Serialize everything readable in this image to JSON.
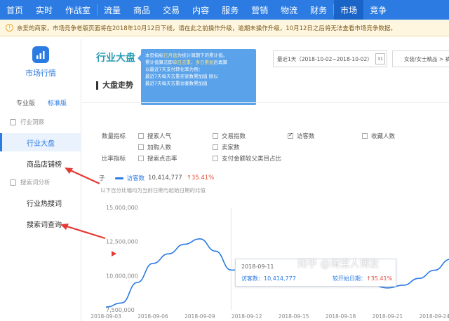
{
  "topnav": {
    "items": [
      {
        "label": "首页"
      },
      {
        "label": "实时"
      },
      {
        "label": "作战室"
      },
      {
        "label": "流量"
      },
      {
        "label": "商品"
      },
      {
        "label": "交易"
      },
      {
        "label": "内容"
      },
      {
        "label": "服务"
      },
      {
        "label": "营销"
      },
      {
        "label": "物流"
      },
      {
        "label": "财务"
      },
      {
        "label": "市场"
      },
      {
        "label": "竞争"
      }
    ],
    "active": "市场"
  },
  "notice": {
    "text": "亲爱的商家，市场竞争老版页面将在2018年10月12日下线，请在此之前操作升级，逾期未操作升级，10月12日之后将无法查看市场竞争数据。"
  },
  "sidebar": {
    "title": "市场行情",
    "version_tabs": [
      "专业版",
      "标准版"
    ],
    "groups": [
      {
        "label": "行业洞察",
        "items": [
          {
            "label": "行业大盘",
            "active": true
          },
          {
            "label": "商品店铺榜"
          }
        ]
      },
      {
        "label": "搜索词分析",
        "items": [
          {
            "label": "行业热搜词"
          },
          {
            "label": "搜索词查询"
          }
        ]
      }
    ]
  },
  "main": {
    "title": "行业大盘",
    "tooltip": {
      "l1a": "本页指标",
      "l1b": "已月盘",
      "l1c": "为统计周期下的累计值。",
      "l2a": "累计值算法即",
      "l2b": "单日去重，多日累加",
      "l2c": "后再算",
      "l3": "以最近7天支付转化率为例：",
      "l4": "最近7天每天去重买家数累加值 除以",
      "l5": "最近7天每天去重访客数累加值"
    },
    "date_range": "最近1天（2018-10-02~2018-10-02）",
    "calendar_label": "31",
    "category": "女装/女士精品 > 裤",
    "section_title": "大盘走势",
    "metric_groups": {
      "quantity_label": "数量指标",
      "ratio_label": "比率指标"
    },
    "checkboxes": [
      {
        "label": "搜索人气",
        "checked": false
      },
      {
        "label": "交易指数",
        "checked": false
      },
      {
        "label": "访客数",
        "checked": true
      },
      {
        "label": "收藏人数",
        "checked": false
      },
      {
        "label": "加购人数",
        "checked": false
      },
      {
        "label": "卖家数",
        "checked": false
      },
      {
        "label": "搜索点击率",
        "checked": false
      },
      {
        "label": "支付金额较父类目占比",
        "checked": false
      }
    ],
    "legend": {
      "prefix": "子",
      "series_name": "访客数",
      "value": "10,414,777",
      "change": "35.41%"
    },
    "chart_note": "以下百分比幅均为当前日期与起始日期的比值",
    "hover": {
      "date": "2018-09-11",
      "value_label": "访客数：",
      "value": "10,414,777",
      "compare_label": "较开始日期：",
      "compare": "35.41%"
    },
    "watermark": "知乎 @淘宝人博友"
  },
  "colors": {
    "brand": "#2b7be3",
    "up": "#e24c3a",
    "arrow": "#e53935"
  },
  "chart_data": {
    "type": "line",
    "x": [
      "2018-09-03",
      "2018-09-04",
      "2018-09-05",
      "2018-09-06",
      "2018-09-07",
      "2018-09-08",
      "2018-09-09",
      "2018-09-10",
      "2018-09-11",
      "2018-09-12",
      "2018-09-13",
      "2018-09-14",
      "2018-09-15",
      "2018-09-16",
      "2018-09-17",
      "2018-09-18",
      "2018-09-19",
      "2018-09-20",
      "2018-09-21",
      "2018-09-22",
      "2018-09-23",
      "2018-09-24",
      "2018-09-25"
    ],
    "xticks": [
      "2018-09-03",
      "2018-09-06",
      "2018-09-09",
      "2018-09-12",
      "2018-09-15",
      "2018-09-18",
      "2018-09-21",
      "2018-09-24"
    ],
    "series": [
      {
        "name": "访客数",
        "values": [
          7700000,
          8000000,
          9500000,
          10900000,
          11600000,
          12300000,
          12700000,
          11800000,
          10414777,
          10400000,
          10500000,
          10800000,
          11000000,
          10800000,
          10700000,
          10200000,
          9700000,
          9300000,
          9100000,
          9300000,
          9800000,
          10400000,
          11200000
        ]
      }
    ],
    "yticks": [
      "15,000,000",
      "12,500,000",
      "10,000,000",
      "7,500,000"
    ],
    "ylim": [
      7500000,
      15000000
    ],
    "grid": false
  }
}
